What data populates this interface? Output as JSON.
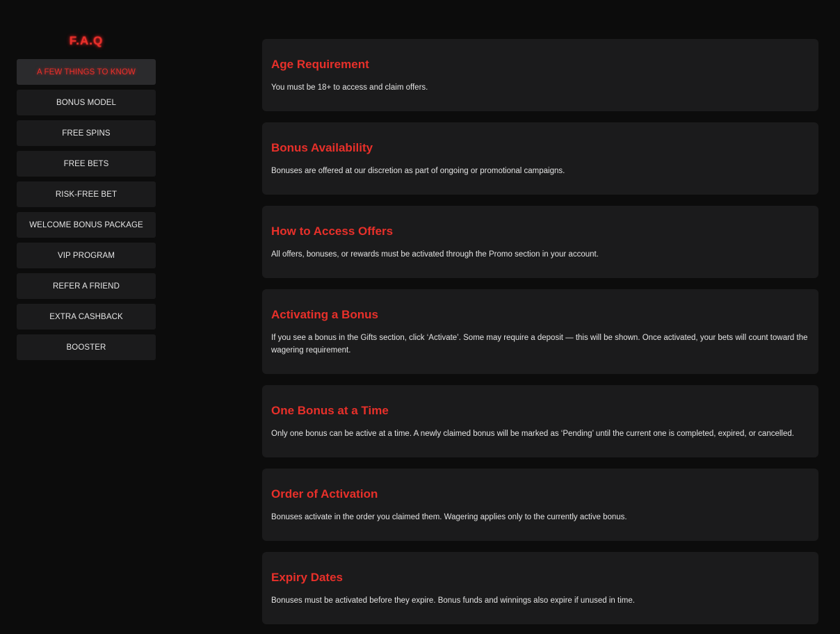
{
  "theme": {
    "accent": "#e8302a",
    "card_bg": "#1b1b1c",
    "page_bg": "#0c0c0c"
  },
  "sidebar": {
    "title": "F.A.Q",
    "active_index": 0,
    "items": [
      {
        "label": "A FEW THINGS TO KNOW"
      },
      {
        "label": "BONUS MODEL"
      },
      {
        "label": "FREE SPINS"
      },
      {
        "label": "FREE BETS"
      },
      {
        "label": "RISK-FREE BET"
      },
      {
        "label": "WELCOME BONUS PACKAGE"
      },
      {
        "label": "VIP PROGRAM"
      },
      {
        "label": "REFER A FRIEND"
      },
      {
        "label": "EXTRA CASHBACK"
      },
      {
        "label": "BOOSTER"
      }
    ]
  },
  "main": {
    "cards": [
      {
        "title": "Age Requirement",
        "text": "You must be 18+ to access and claim offers."
      },
      {
        "title": "Bonus Availability",
        "text": "Bonuses are offered at our discretion as part of ongoing or promotional campaigns."
      },
      {
        "title": "How to Access Offers",
        "text": "All offers, bonuses, or rewards must be activated through the Promo section in your account."
      },
      {
        "title": "Activating a Bonus",
        "text": "If you see a bonus in the Gifts section, click ‘Activate’. Some may require a deposit — this will be shown. Once activated, your bets will count toward the wagering requirement."
      },
      {
        "title": "One Bonus at a Time",
        "text": "Only one bonus can be active at a time. A newly claimed bonus will be marked as ‘Pending’ until the current one is completed, expired, or cancelled."
      },
      {
        "title": "Order of Activation",
        "text": "Bonuses activate in the order you claimed them. Wagering applies only to the currently active bonus."
      },
      {
        "title": "Expiry Dates",
        "text": "Bonuses must be activated before they expire. Bonus funds and winnings also expire if unused in time."
      }
    ]
  }
}
